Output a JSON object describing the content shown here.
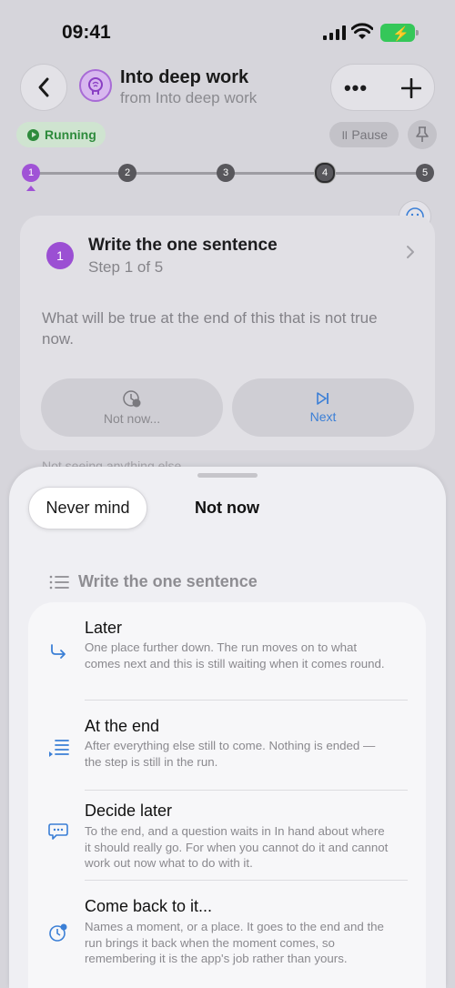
{
  "status_bar": {
    "time": "09:41"
  },
  "header": {
    "title": "Into deep work",
    "subtitle": "from Into deep work",
    "more_label": "•••"
  },
  "run_state": {
    "running_label": "Running",
    "pause_label": "Pause"
  },
  "stepper": {
    "steps": [
      "1",
      "2",
      "3",
      "4",
      "5"
    ],
    "current": 1
  },
  "step_card": {
    "number": "1",
    "title": "Write the one sentence",
    "step_label": "Step 1 of 5",
    "body": "What will be true at the end of this that is not true now.",
    "not_now_label": "Not now...",
    "next_label": "Next"
  },
  "peek_text": "Not seeing anything else",
  "sheet": {
    "cancel_label": "Never mind",
    "title": "Not now",
    "section_title": "Write the one sentence",
    "options": [
      {
        "title": "Later",
        "description": "One place further down. The run moves on to what comes next and this is still waiting when it comes round.",
        "icon": "arrow-turn-right-icon"
      },
      {
        "title": "At the end",
        "description": "After everything else still to come. Nothing is ended — the step is still in the run.",
        "icon": "list-end-icon"
      },
      {
        "title": "Decide later",
        "description": "To the end, and a question waits in In hand about where it should really go. For when you cannot do it and cannot work out now what to do with it.",
        "icon": "speech-bubble-icon"
      },
      {
        "title": "Come back to it...",
        "description": "Names a moment, or a place. It goes to the end and the run brings it back when the moment comes, so remembering it is the app's job rather than yours.",
        "icon": "clock-badge-icon"
      }
    ]
  },
  "colors": {
    "accent_purple": "#a053d6",
    "accent_blue": "#3b7fd6",
    "running_green": "#2e8b3c"
  }
}
